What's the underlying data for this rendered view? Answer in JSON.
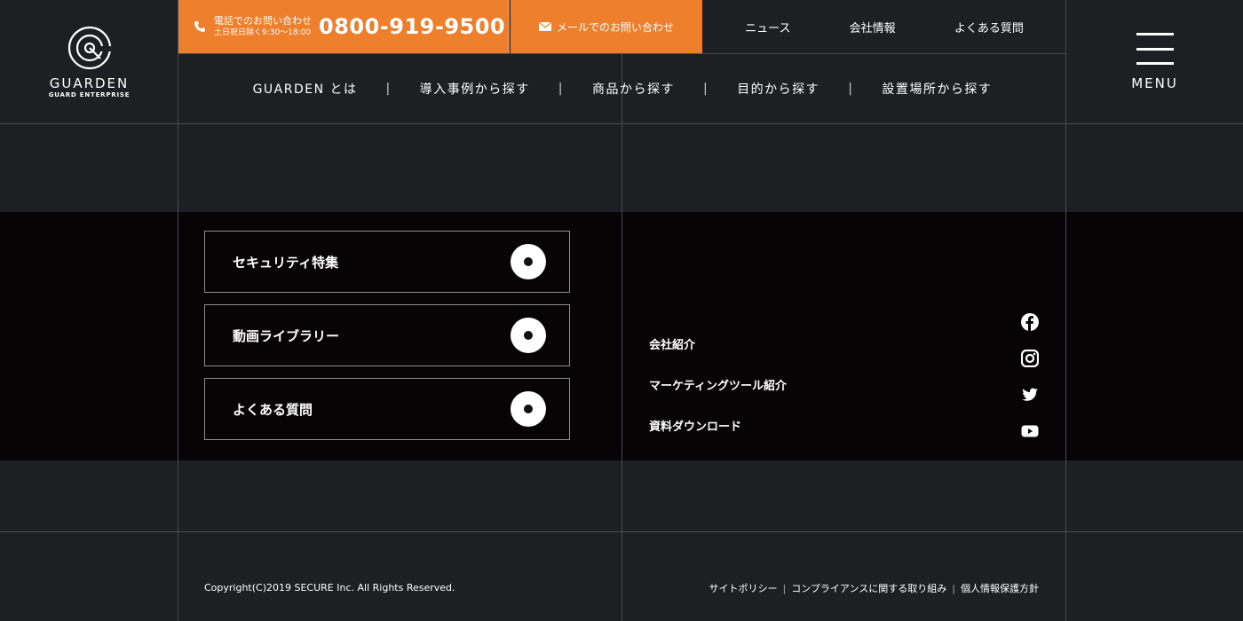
{
  "logo": {
    "wordmark": "GUARDEN",
    "tagline": "GUARD ENTERPRISE"
  },
  "contact": {
    "phone_label": "電話でのお問い合わせ",
    "phone_hours": "土日祝日除く9:30〜18:00",
    "phone_number": "0800-919-9500",
    "mail_label": "メールでのお問い合わせ",
    "accent_color": "#ee7f2d"
  },
  "top_links": [
    "ニュース",
    "会社情報",
    "よくある質問"
  ],
  "nav": {
    "items": [
      "GUARDEN とは",
      "導入事例から探す",
      "商品から探す",
      "目的から探す",
      "設置場所から探す"
    ],
    "separator": "|"
  },
  "menu": {
    "label": "MENU",
    "icon": "hamburger-icon"
  },
  "features": [
    {
      "label": "セキュリティ特集",
      "icon": "circle-arrow-icon"
    },
    {
      "label": "動画ライブラリー",
      "icon": "circle-arrow-icon"
    },
    {
      "label": "よくある質問",
      "icon": "circle-arrow-icon"
    }
  ],
  "sub_links": [
    "会社紹介",
    "マーケティングツール紹介",
    "資料ダウンロード"
  ],
  "social": [
    "facebook-icon",
    "instagram-icon",
    "twitter-icon",
    "youtube-icon"
  ],
  "footer": {
    "copyright": "Copyright(C)2019 SECURE Inc. All Rights Reserved.",
    "links": [
      "サイトポリシー",
      "コンプライアンスに関する取り組み",
      "個人情報保護方針"
    ],
    "separator": "|"
  }
}
